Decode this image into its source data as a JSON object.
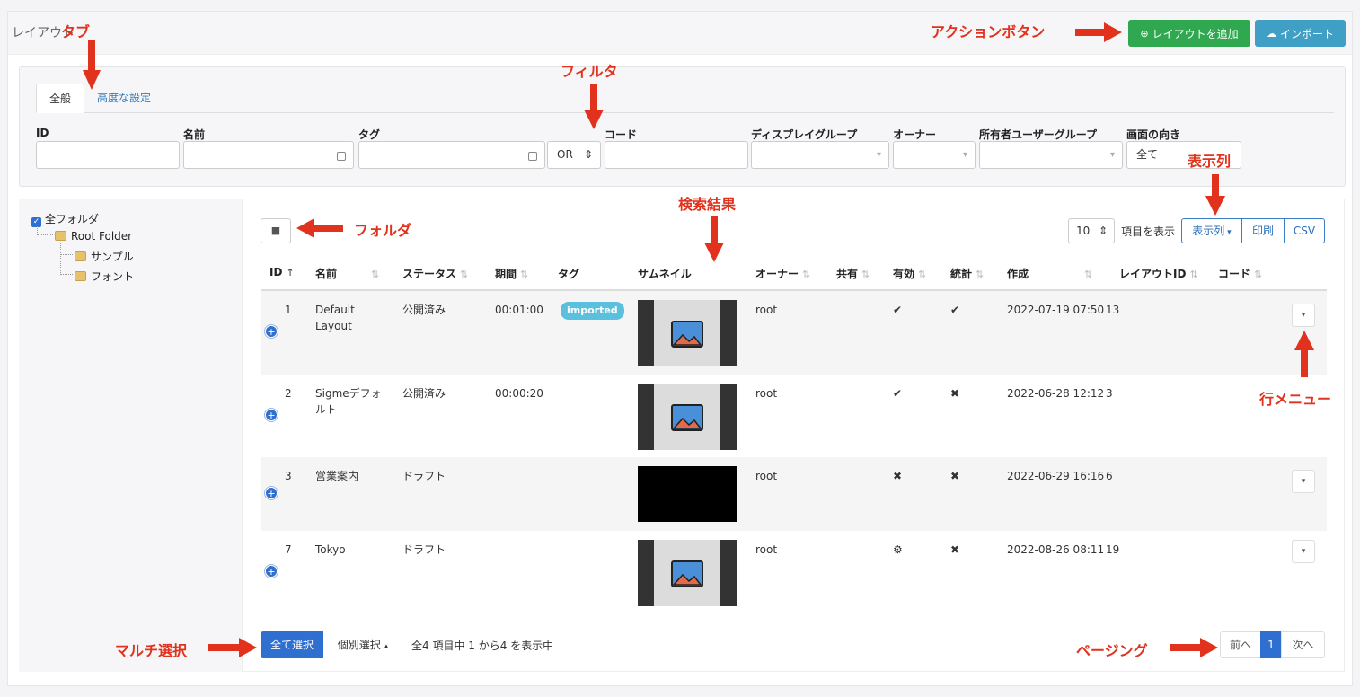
{
  "header": {
    "title": "レイアウト",
    "add_button": "レイアウトを追加",
    "import_button": "インポート"
  },
  "filter": {
    "tabs": [
      "全般",
      "高度な設定"
    ],
    "labels": {
      "id": "ID",
      "name": "名前",
      "tag": "タグ",
      "code": "コード",
      "display_group": "ディスプレイグループ",
      "owner": "オーナー",
      "owner_user_group": "所有者ユーザーグループ",
      "orientation": "画面の向き"
    },
    "tag_operator": "OR",
    "orientation_value": "全て"
  },
  "folder_tree": {
    "root_label": "全フォルダ",
    "items": [
      "Root Folder",
      "サンプル",
      "フォント"
    ]
  },
  "table_tools": {
    "page_length": "10",
    "page_length_label": "項目を表示",
    "columns_button": "表示列",
    "print_button": "印刷",
    "csv_button": "CSV"
  },
  "table": {
    "columns": [
      "ID",
      "名前",
      "ステータス",
      "期間",
      "タグ",
      "サムネイル",
      "オーナー",
      "共有",
      "有効",
      "統計",
      "作成",
      "レイアウトID",
      "コード"
    ],
    "rows": [
      {
        "id": "1",
        "name": "Default Layout",
        "status": "公開済み",
        "duration": "00:01:00",
        "tag": "imported",
        "thumb": "image",
        "owner": "root",
        "enabled": "✔",
        "stats": "✔",
        "created": "2022-07-19 07:50",
        "layout_id": "13"
      },
      {
        "id": "2",
        "name": "Sigmeデフォルト",
        "status": "公開済み",
        "duration": "00:00:20",
        "tag": "",
        "thumb": "image",
        "owner": "root",
        "enabled": "✔",
        "stats": "✖",
        "created": "2022-06-28 12:12",
        "layout_id": "3"
      },
      {
        "id": "3",
        "name": "営業案内",
        "status": "ドラフト",
        "duration": "",
        "tag": "",
        "thumb": "black",
        "owner": "root",
        "enabled": "✖",
        "stats": "✖",
        "created": "2022-06-29 16:16",
        "layout_id": "6"
      },
      {
        "id": "7",
        "name": "Tokyo",
        "status": "ドラフト",
        "duration": "",
        "tag": "",
        "thumb": "image",
        "owner": "root",
        "enabled": "⚙",
        "stats": "✖",
        "created": "2022-08-26 08:11",
        "layout_id": "19"
      }
    ]
  },
  "footer": {
    "select_all": "全て選択",
    "select_each": "個別選択",
    "info": "全4 項目中 1 から4 を表示中",
    "prev": "前へ",
    "page": "1",
    "next": "次へ"
  },
  "annotations": {
    "tab": "タブ",
    "action_buttons": "アクションボタン",
    "filter": "フィルタ",
    "columns": "表示列",
    "search_results": "検索結果",
    "folder": "フォルダ",
    "row_menu": "行メニュー",
    "multi_select": "マルチ選択",
    "paging": "ページング"
  },
  "colors": {
    "accent": "#2f6fcf",
    "add": "#2fa84f",
    "import": "#3f9fc4",
    "annotation": "#e0321c"
  }
}
